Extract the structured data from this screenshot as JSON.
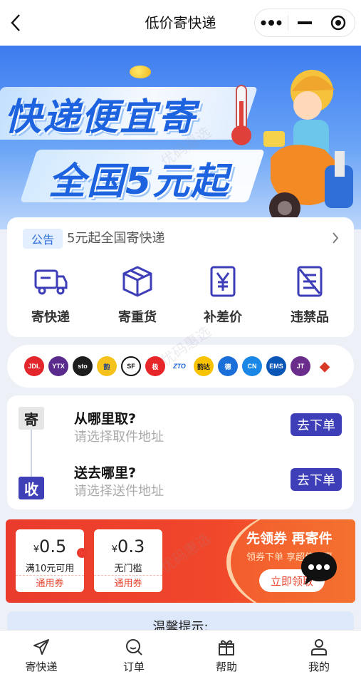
{
  "header": {
    "title": "低价寄快递"
  },
  "banner": {
    "line1": "快递便宜寄",
    "line2": "全国5元起"
  },
  "notice": {
    "tag": "公告",
    "text": "5元起全国寄快递"
  },
  "services": [
    {
      "label": "寄快递",
      "icon": "truck-icon"
    },
    {
      "label": "寄重货",
      "icon": "box-icon"
    },
    {
      "label": "补差价",
      "icon": "yen-icon"
    },
    {
      "label": "违禁品",
      "icon": "prohibited-icon"
    }
  ],
  "carriers": [
    {
      "name": "jdl-logo",
      "text": "JDL",
      "color": "#e3262b"
    },
    {
      "name": "ytx-logo",
      "text": "YTX",
      "color": "#5a2a8c"
    },
    {
      "name": "sto-logo",
      "text": "sto",
      "color": "#1d1d1d"
    },
    {
      "name": "yunda-logo",
      "text": "韵",
      "color": "#f4c21a"
    },
    {
      "name": "sf-logo",
      "text": "SF",
      "color": "#111111"
    },
    {
      "name": "best-logo",
      "text": "极",
      "color": "#e7262a"
    },
    {
      "name": "zto-logo",
      "text": "ZTO",
      "color": "#ffffff"
    },
    {
      "name": "yto-logo",
      "text": "韵达",
      "color": "#f7c300"
    },
    {
      "name": "deppon-logo",
      "text": "德",
      "color": "#1b6fd8"
    },
    {
      "name": "cainiao-logo",
      "text": "CN",
      "color": "#1a86e6"
    },
    {
      "name": "ems-logo",
      "text": "EMS",
      "color": "#0a56b7"
    },
    {
      "name": "jt-logo",
      "text": "JT",
      "color": "#6b2d8c"
    },
    {
      "name": "anneng-logo",
      "text": "◆",
      "color": "#ffffff"
    }
  ],
  "address": {
    "send_tag": "寄",
    "recv_tag": "收",
    "from_title": "从哪里取?",
    "from_placeholder": "请选择取件地址",
    "to_title": "送去哪里?",
    "to_placeholder": "请选择送件地址",
    "order_label": "去下单"
  },
  "coupons": [
    {
      "yen": "¥",
      "value": "0.5",
      "condition": "满10元可用",
      "type": "通用券"
    },
    {
      "yen": "¥",
      "value": "0.3",
      "condition": "无门槛",
      "type": "通用券"
    }
  ],
  "promo": {
    "title": "先领券 再寄件",
    "subtitle": "领券下单 享超值优惠",
    "button": "立即领取"
  },
  "tips": {
    "title": "温馨提示:"
  },
  "tabbar": [
    {
      "label": "寄快递",
      "icon": "send-icon"
    },
    {
      "label": "订单",
      "icon": "search-order-icon"
    },
    {
      "label": "帮助",
      "icon": "gift-icon"
    },
    {
      "label": "我的",
      "icon": "user-icon"
    }
  ],
  "watermark": "优码惠选",
  "colors": {
    "primary": "#3e3eb8",
    "coupon_red": "#ea3b2c",
    "banner_blue": "#3d7cf0"
  }
}
